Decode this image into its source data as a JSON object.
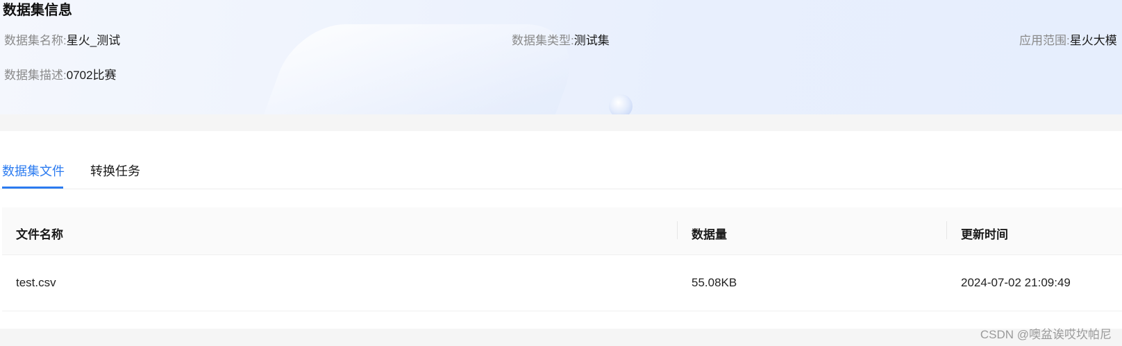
{
  "info": {
    "title": "数据集信息",
    "name_label": "数据集名称:",
    "name_value": "星火_测试",
    "type_label": "数据集类型:",
    "type_value": "测试集",
    "scope_label": "应用范围:",
    "scope_value": "星火大模",
    "desc_label": "数据集描述:",
    "desc_value": "0702比赛"
  },
  "tabs": [
    {
      "label": "数据集文件",
      "active": true
    },
    {
      "label": "转换任务",
      "active": false
    }
  ],
  "table": {
    "columns": [
      "文件名称",
      "数据量",
      "更新时间"
    ],
    "rows": [
      {
        "file_name": "test.csv",
        "size": "55.08KB",
        "updated": "2024-07-02 21:09:49"
      }
    ]
  },
  "watermark": "CSDN @噢盆诶哎坎帕尼",
  "colors": {
    "accent": "#2b7bf0"
  }
}
